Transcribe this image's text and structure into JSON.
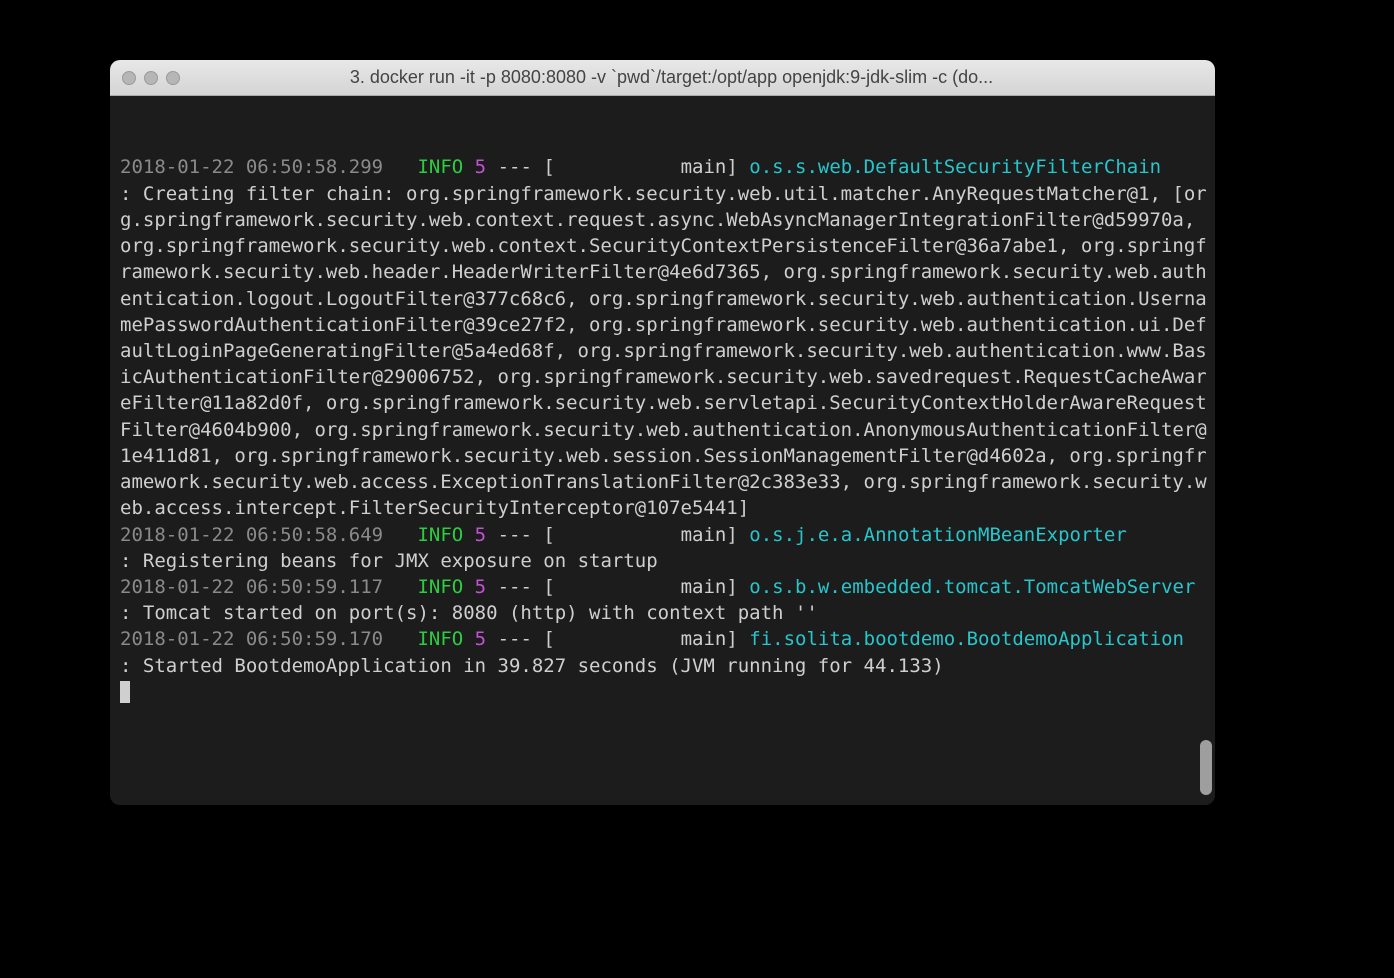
{
  "window": {
    "title": "3. docker run -it -p 8080:8080 -v `pwd`/target:/opt/app openjdk:9-jdk-slim  -c  (do..."
  },
  "log": {
    "thread": "main",
    "entries": [
      {
        "timestamp": "2018-01-22 06:50:58.299",
        "level": "INFO",
        "pid": "5",
        "logger": "o.s.s.web.DefaultSecurityFilterChain",
        "message": "Creating filter chain: org.springframework.security.web.util.matcher.AnyRequestMatcher@1, [org.springframework.security.web.context.request.async.WebAsyncManagerIntegrationFilter@d59970a, org.springframework.security.web.context.SecurityContextPersistenceFilter@36a7abe1, org.springframework.security.web.header.HeaderWriterFilter@4e6d7365, org.springframework.security.web.authentication.logout.LogoutFilter@377c68c6, org.springframework.security.web.authentication.UsernamePasswordAuthenticationFilter@39ce27f2, org.springframework.security.web.authentication.ui.DefaultLoginPageGeneratingFilter@5a4ed68f, org.springframework.security.web.authentication.www.BasicAuthenticationFilter@29006752, org.springframework.security.web.savedrequest.RequestCacheAwareFilter@11a82d0f, org.springframework.security.web.servletapi.SecurityContextHolderAwareRequestFilter@4604b900, org.springframework.security.web.authentication.AnonymousAuthenticationFilter@1e411d81, org.springframework.security.web.session.SessionManagementFilter@d4602a, org.springframework.security.web.access.ExceptionTranslationFilter@2c383e33, org.springframework.security.web.access.intercept.FilterSecurityInterceptor@107e5441]"
      },
      {
        "timestamp": "2018-01-22 06:50:58.649",
        "level": "INFO",
        "pid": "5",
        "logger": "o.s.j.e.a.AnnotationMBeanExporter",
        "message": "Registering beans for JMX exposure on startup"
      },
      {
        "timestamp": "2018-01-22 06:50:59.117",
        "level": "INFO",
        "pid": "5",
        "logger": "o.s.b.w.embedded.tomcat.TomcatWebServer",
        "message": "Tomcat started on port(s): 8080 (http) with context path ''"
      },
      {
        "timestamp": "2018-01-22 06:50:59.170",
        "level": "INFO",
        "pid": "5",
        "logger": "fi.solita.bootdemo.BootdemoApplication",
        "message": "Started BootdemoApplication in 39.827 seconds (JVM running for 44.133)"
      }
    ]
  },
  "layout": {
    "timestamp_pad": 24,
    "level_pad": 5,
    "logger_pad": 40,
    "thread_pad": 15
  }
}
